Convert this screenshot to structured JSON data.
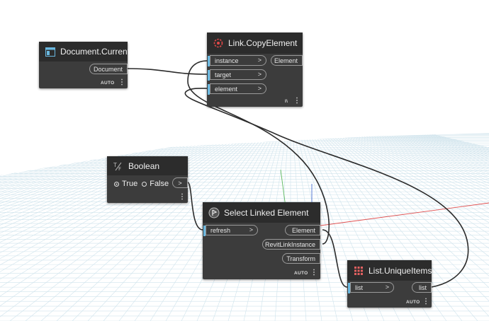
{
  "nodes": {
    "document_current": {
      "title": "Document.Current",
      "icon": "document-icon",
      "output": "Document",
      "lacing": "AUTO"
    },
    "link_copy_element": {
      "title": "Link.CopyElement",
      "icon": "link-copy-icon",
      "inputs": [
        "instance",
        "target",
        "element"
      ],
      "output": "Element",
      "lacing": "l\\"
    },
    "boolean": {
      "title": "Boolean",
      "icon": "boolean-icon",
      "true_label": "True",
      "false_label": "False",
      "selected": "True"
    },
    "select_linked_element": {
      "title": "Select Linked Element",
      "icon": "select-icon",
      "inputs": [
        "refresh"
      ],
      "outputs": [
        "Element",
        "RevitLinkInstance",
        "Transform"
      ],
      "lacing": "AUTO"
    },
    "list_unique_items": {
      "title": "List.UniqueItems",
      "icon": "list-icon",
      "inputs": [
        "list"
      ],
      "output": "list",
      "lacing": "AUTO"
    }
  },
  "port_arrow": ">",
  "colors": {
    "node_body": "#3c3c3c",
    "node_header": "#2c2c2c",
    "input_accent": "#6ab8e0",
    "wire": "#2b2b2b",
    "grid": "#cfe3ec"
  }
}
